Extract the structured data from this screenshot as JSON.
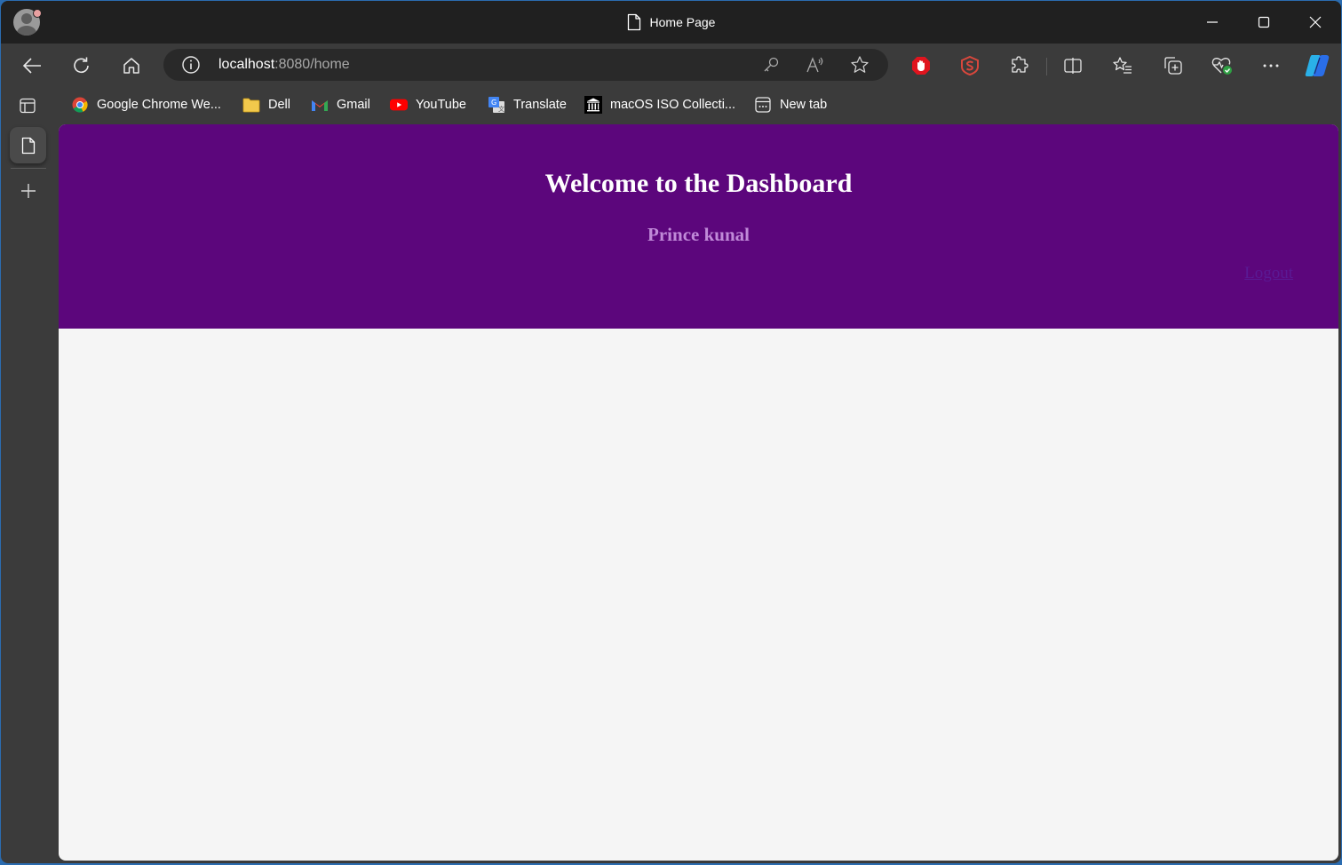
{
  "browser": {
    "window_title": "Home Page",
    "address": {
      "host": "localhost",
      "rest": ":8080/home"
    },
    "toolbar": {
      "back": "back-icon",
      "refresh": "refresh-icon",
      "home": "home-icon",
      "site_info": "info-icon",
      "password": "key-icon",
      "read_aloud": "read-aloud-icon",
      "favorite": "star-icon",
      "extensions": [
        "adblock-icon",
        "extension-s-icon",
        "extensions-puzzle-icon"
      ],
      "split_screen": "split-screen-icon",
      "favorites": "favorites-list-icon",
      "collections": "collections-icon",
      "browser_essentials": "heart-pulse-icon",
      "more": "more-icon",
      "copilot": "copilot-icon"
    },
    "bookmarks": [
      {
        "label": "Google Chrome We...",
        "icon": "chrome-icon"
      },
      {
        "label": "Dell",
        "icon": "folder-icon"
      },
      {
        "label": "Gmail",
        "icon": "gmail-icon"
      },
      {
        "label": "YouTube",
        "icon": "youtube-icon"
      },
      {
        "label": "Translate",
        "icon": "translate-icon"
      },
      {
        "label": "macOS ISO Collecti...",
        "icon": "archive-icon"
      },
      {
        "label": "New tab",
        "icon": "new-tab-icon"
      }
    ]
  },
  "page": {
    "title": "Welcome to the Dashboard",
    "user_name": "Prince kunal",
    "logout_label": "Logout",
    "colors": {
      "header_bg": "#5c067c",
      "title": "#ffffff",
      "user_name": "#c08ad8",
      "logout": "#5a1a94",
      "body_bg": "#f5f5f5"
    }
  }
}
